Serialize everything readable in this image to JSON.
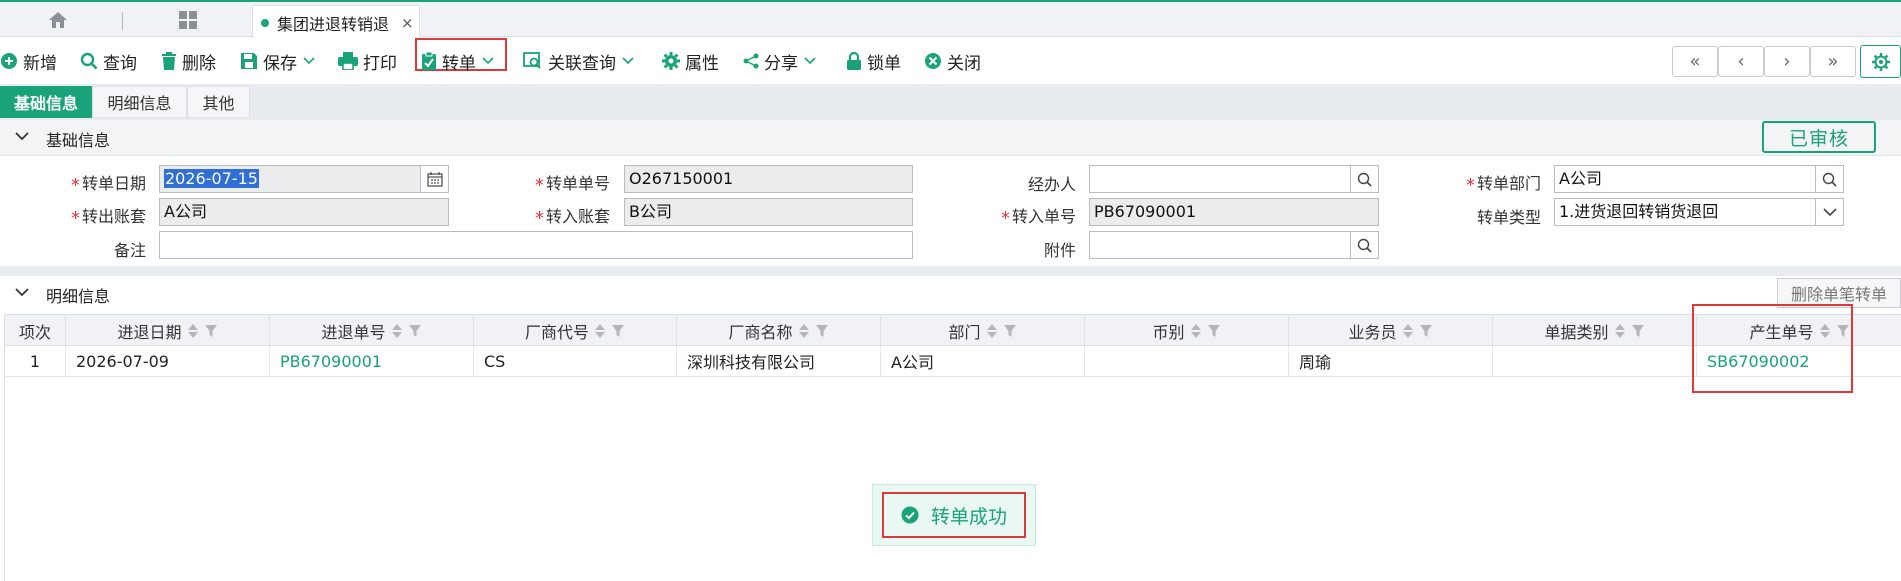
{
  "tabstrip": {
    "active_tab_title": "集团进退转销退",
    "close_glyph": "×"
  },
  "toolbar": {
    "add": "新增",
    "query": "查询",
    "delete": "删除",
    "save": "保存",
    "print": "打印",
    "transfer": "转单",
    "related_query": "关联查询",
    "attributes": "属性",
    "share": "分享",
    "lock": "锁单",
    "close": "关闭",
    "nav": [
      "«",
      "‹",
      "›",
      "»"
    ]
  },
  "section_tabs": [
    "基础信息",
    "明细信息",
    "其他"
  ],
  "basic": {
    "group_title": "基础信息",
    "status": "已审核",
    "fields": {
      "transfer_date_label": "转单日期",
      "transfer_date": "2026-07-15",
      "transfer_no_label": "转单单号",
      "transfer_no": "O267150001",
      "handler_label": "经办人",
      "handler": "",
      "transfer_dept_label": "转单部门",
      "transfer_dept": "A公司",
      "out_account_label": "转出账套",
      "out_account": "A公司",
      "in_account_label": "转入账套",
      "in_account": "B公司",
      "in_no_label": "转入单号",
      "in_no": "PB67090001",
      "transfer_type_label": "转单类型",
      "transfer_type": "1.进货退回转销货退回",
      "remark_label": "备注",
      "remark": "",
      "attachment_label": "附件",
      "attachment": ""
    }
  },
  "detail": {
    "group_title": "明细信息",
    "delete_button": "删除单笔转单",
    "columns": [
      "项次",
      "进退日期",
      "进退单号",
      "厂商代号",
      "厂商名称",
      "部门",
      "币别",
      "业务员",
      "单据类别",
      "产生单号"
    ],
    "rows": [
      {
        "seq": "1",
        "date": "2026-07-09",
        "order_no": "PB67090001",
        "vendor_code": "CS",
        "vendor_name": "深圳科技有限公司",
        "dept": "A公司",
        "currency": "",
        "salesman": "周瑜",
        "doc_type": "",
        "generated_no": "SB67090002"
      }
    ]
  },
  "toast": {
    "message": "转单成功"
  },
  "colors": {
    "accent": "#1aa37a",
    "highlight": "#e0373b"
  }
}
